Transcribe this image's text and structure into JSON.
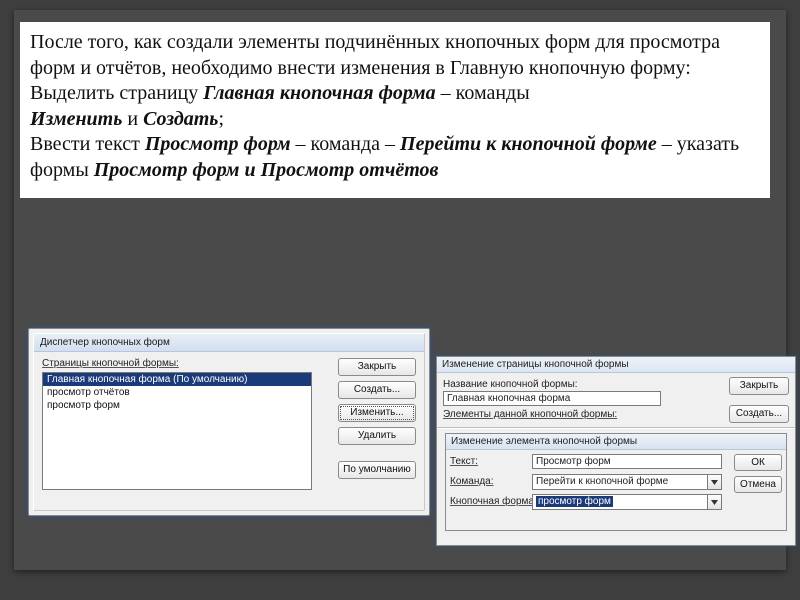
{
  "text": {
    "p1a": "После того, как создали элементы подчинённых кнопочных форм для просмотра форм и отчётов, необходимо внести изменения в Главную кнопочную форму:",
    "p2a": "Выделить страницу ",
    "p2b": "Главная кнопочная форма",
    "p2c": " – команды ",
    "p2d": "Изменить",
    "p2e": " и ",
    "p2f": "Создать",
    "p2g": ";",
    "p3a": "Ввести текст  ",
    "p3b": "Просмотр форм",
    "p3c": " – команда – ",
    "p3d": "Перейти к кнопочной форме",
    "p3e": " – указать формы ",
    "p3f": "Просмотр  форм и Просмотр отчётов"
  },
  "dlg1": {
    "title": "Диспетчер кнопочных форм",
    "pages_label": "Страницы кнопочной формы:",
    "list": {
      "0": "Главная кнопочная форма (По умолчанию)",
      "1": "просмотр отчётов",
      "2": "просмотр форм"
    },
    "btn_close": "Закрыть",
    "btn_new": "Создать...",
    "btn_edit": "Изменить...",
    "btn_delete": "Удалить",
    "btn_default": "По умолчанию"
  },
  "dlg2": {
    "title": "Изменение страницы кнопочной формы",
    "name_label": "Название кнопочной формы:",
    "name_value": "Главная кнопочная форма",
    "items_label": "Элементы данной кнопочной формы:",
    "btn_close": "Закрыть",
    "btn_new": "Создать..."
  },
  "dlg3": {
    "title": "Изменение элемента кнопочной формы",
    "lbl_text": "Текст:",
    "val_text": "Просмотр форм",
    "lbl_cmd": "Команда:",
    "val_cmd": "Перейти к кнопочной форме",
    "lbl_form": "Кнопочная форма:",
    "val_form": "просмотр форм",
    "btn_ok": "ОК",
    "btn_cancel": "Отмена"
  }
}
